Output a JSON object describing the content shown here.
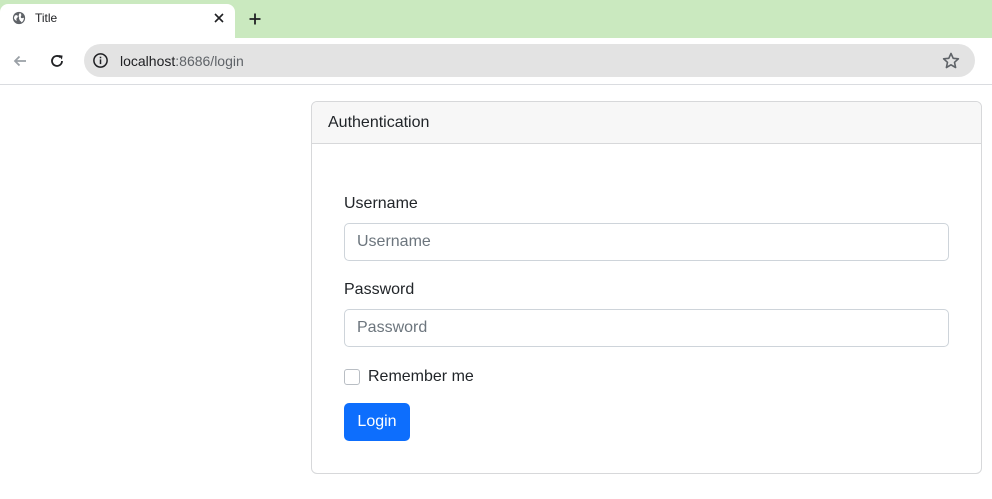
{
  "browser": {
    "tab": {
      "title": "Title",
      "favicon": "globe-icon"
    },
    "url": {
      "host": "localhost",
      "rest": ":8686/login"
    },
    "icons": [
      "back-arrow-icon",
      "reload-icon",
      "info-icon",
      "star-icon",
      "close-icon",
      "plus-icon"
    ],
    "colors": {
      "tabstrip": "#cae9bf",
      "omnibox": "#e3e3e3"
    }
  },
  "card": {
    "header": "Authentication",
    "username": {
      "label": "Username",
      "placeholder": "Username",
      "value": ""
    },
    "password": {
      "label": "Password",
      "placeholder": "Password",
      "value": ""
    },
    "remember": {
      "label": "Remember me",
      "checked": false
    },
    "login_label": "Login"
  },
  "colors": {
    "primary": "#0d6efd",
    "header_bg": "#f7f7f7",
    "border": "#d7d8da"
  }
}
